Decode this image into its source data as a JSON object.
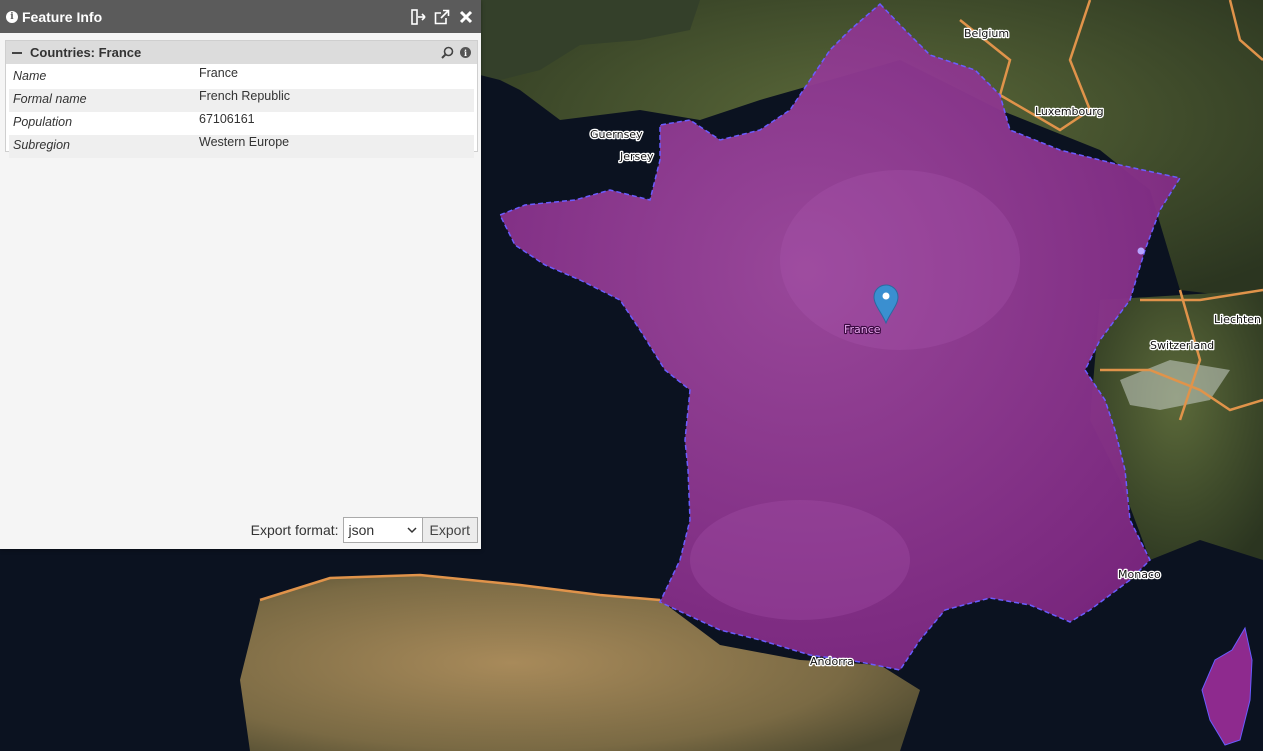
{
  "panel": {
    "title": "Feature Info",
    "group_title": "Countries: France",
    "attributes": [
      {
        "key": "Name",
        "value": "France"
      },
      {
        "key": "Formal name",
        "value": "French Republic"
      },
      {
        "key": "Population",
        "value": "67106161"
      },
      {
        "key": "Subregion",
        "value": "Western Europe"
      }
    ],
    "export_label": "Export format:",
    "export_format": "json",
    "export_button": "Export"
  },
  "map": {
    "labels": {
      "belgium": "Belgium",
      "luxembourg": "Luxembourg",
      "guernsey": "Guernsey",
      "jersey": "Jersey",
      "france": "France",
      "liechtenstein": "Liechten",
      "switzerland": "Switzerland",
      "monaco": "Monaco",
      "andorra": "Andorra"
    },
    "colors": {
      "highlight_fill": "#8e2a8e",
      "highlight_border": "#6a5cff",
      "marker": "#3a8fd0",
      "sea": "#0b1220",
      "border": "#e0934a"
    },
    "marker_icon": "map-pin-icon"
  }
}
